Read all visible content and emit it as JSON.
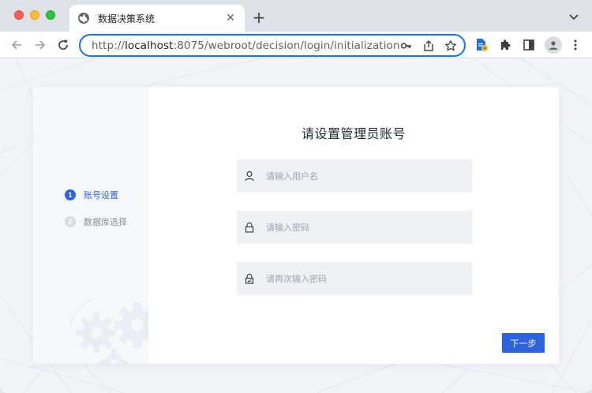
{
  "browser": {
    "tab_title": "数据决策系统",
    "tab_close": "✕",
    "new_tab": "+",
    "url_prefix": "http://",
    "url_host": "localhost",
    "url_rest": ":8075/webroot/decision/login/initialization"
  },
  "steps": [
    {
      "number": "1",
      "label": "账号设置",
      "active": true
    },
    {
      "number": "2",
      "label": "数据库选择",
      "active": false
    }
  ],
  "form": {
    "title": "请设置管理员账号",
    "username_placeholder": "请输入用户名",
    "password_placeholder": "请输入密码",
    "confirm_placeholder": "请再次输入密码",
    "username_value": "",
    "password_value": "",
    "confirm_value": "",
    "next_label": "下一步"
  },
  "colors": {
    "accent": "#2c63dd",
    "omnibox_focus": "#1a73e8",
    "field_bg": "#eff1f5",
    "step_inactive": "#d9dce2"
  }
}
